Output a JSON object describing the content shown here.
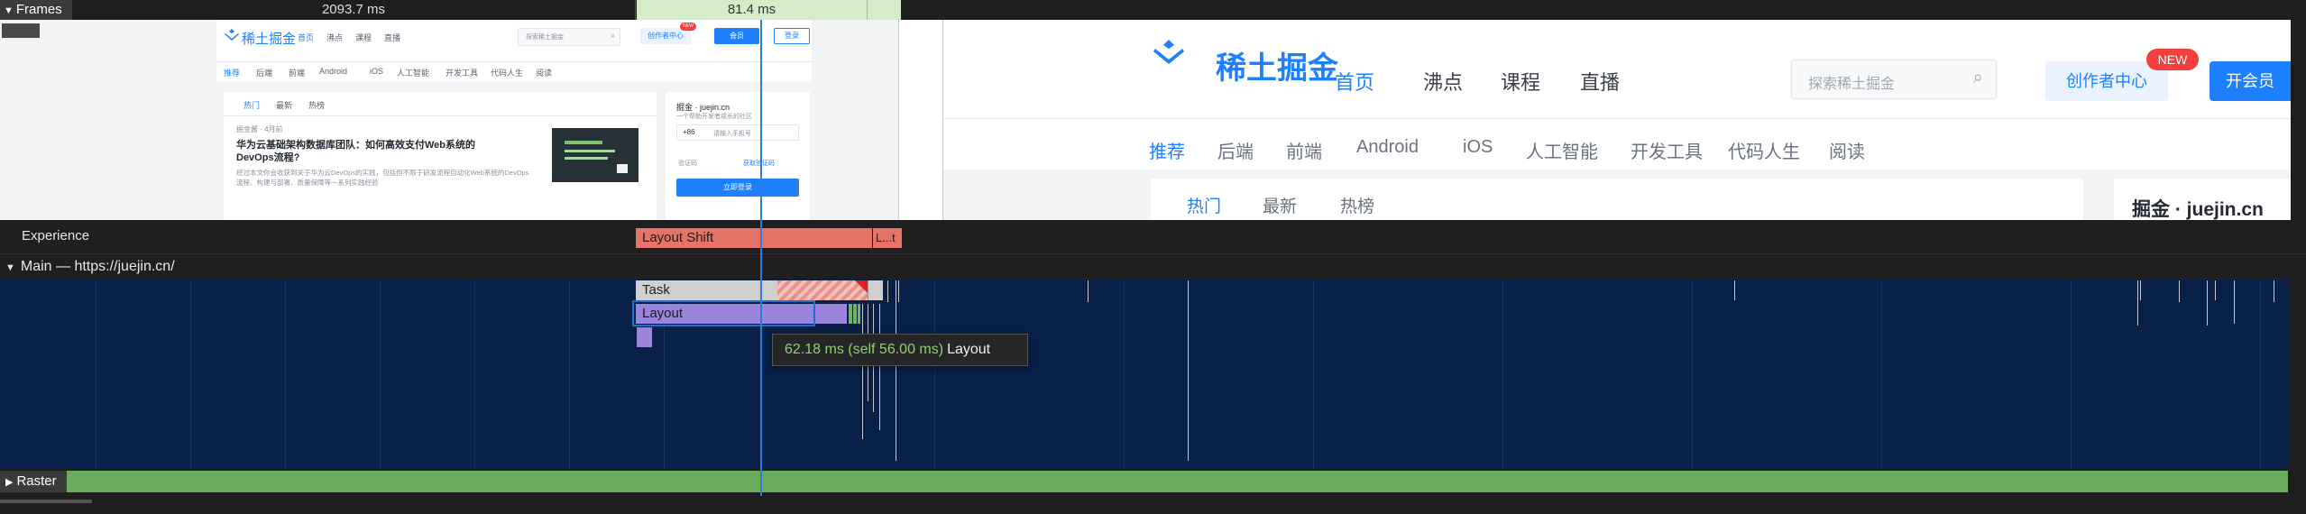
{
  "frames": {
    "label": "Frames",
    "frame_durations": [
      "2093.7 ms",
      "81.4 ms"
    ]
  },
  "filmstrip": {
    "small": {
      "logo": "稀土掘金",
      "nav": [
        "首页",
        "沸点",
        "课程",
        "直播"
      ],
      "search_placeholder": "探索稀土掘金",
      "creator_button": "创作者中心",
      "badge": "NEW",
      "vip_button": "会员",
      "login_button": "登录",
      "categories": [
        "推荐",
        "后端",
        "前端",
        "Android",
        "iOS",
        "人工智能",
        "开发工具",
        "代码人生",
        "阅读"
      ],
      "tabs": [
        "热门",
        "最新",
        "热榜"
      ],
      "meta": "掘金酱 · 4月前",
      "article_title": "华为云基础架构数据库团队：如何高效支付Web系统的DevOps流程?",
      "article_snippet": "经过本文你会收获到关于华为云DevOps的实践，包括但不限于研发流程自动化Web系统的DevOps流程、构建与部署、质量保障等一系列实践经验",
      "promo_title": "掘金 · juejin.cn",
      "promo_subtitle": "一个帮助开发者成长的社区",
      "phone_prefix": "+86",
      "phone_placeholder": "请输入手机号",
      "code_label": "验证码",
      "code_link": "获取验证码",
      "promo_button": "立即登录"
    },
    "large": {
      "logo": "稀土掘金",
      "nav": [
        "首页",
        "沸点",
        "课程",
        "直播"
      ],
      "search_placeholder": "探索稀土掘金",
      "creator_button": "创作者中心",
      "badge": "NEW",
      "vip_button": "开会员",
      "categories": [
        "推荐",
        "后端",
        "前端",
        "Android",
        "iOS",
        "人工智能",
        "开发工具",
        "代码人生",
        "阅读"
      ],
      "tabs": [
        "热门",
        "最新",
        "热榜"
      ],
      "promo_title": "掘金 · juejin.cn"
    }
  },
  "tracks": {
    "experience": {
      "label": "Experience",
      "events": [
        "Layout Shift",
        "L...t"
      ]
    },
    "main": {
      "label": "Main — https://juejin.cn/",
      "events": [
        "Task",
        "Layout"
      ]
    },
    "raster": {
      "label": "Raster"
    }
  },
  "tooltip": {
    "time": "62.18 ms (self 56.00 ms)",
    "name": "Layout"
  },
  "colors": {
    "main_bg": "#092048",
    "layout_shift": "#e57368",
    "layout": "#9a84dc",
    "task": "#cfcfcf",
    "raster": "#6aac5e",
    "playhead": "#2a7fd4",
    "frame_selected": "#d4ecc7"
  }
}
